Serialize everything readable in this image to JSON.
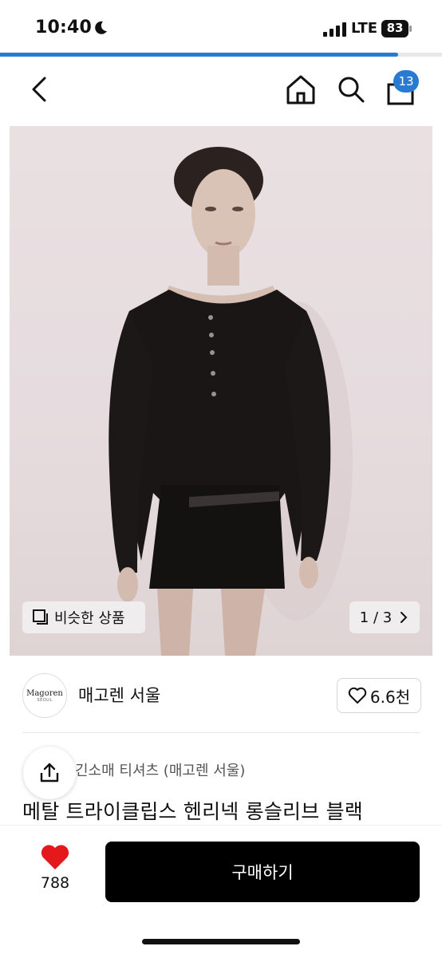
{
  "status_bar": {
    "time": "10:40",
    "network": "LTE",
    "battery": "83"
  },
  "progress": {
    "fraction": 0.9
  },
  "nav": {
    "cart_count": "13"
  },
  "gallery": {
    "similar_label": "비슷한 상품",
    "page_indicator": "1 / 3"
  },
  "brand": {
    "name": "매고렌 서울",
    "logo_text": "Magoren",
    "logo_sub": "SEOUL",
    "likes": "6.6천"
  },
  "product": {
    "category": "긴소매 티셔츠 (매고렌 서울)",
    "title": "메탈 트라이클립스 헨리넥 롱슬리브 블랙"
  },
  "bottom": {
    "wish_count": "788",
    "buy_label": "구매하기"
  },
  "colors": {
    "accent": "#2b7ad1",
    "wish": "#e3191b",
    "buy": "#000000"
  }
}
